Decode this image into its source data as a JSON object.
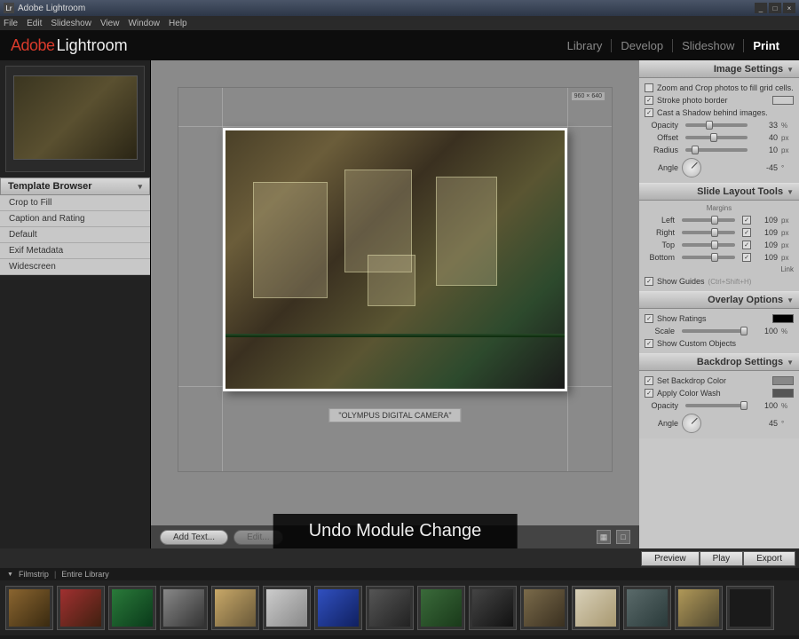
{
  "window": {
    "title": "Adobe Lightroom",
    "minimize": "_",
    "maximize": "□",
    "close": "×"
  },
  "menubar": [
    "File",
    "Edit",
    "Slideshow",
    "View",
    "Window",
    "Help"
  ],
  "brand": {
    "adobe": "Adobe",
    "lightroom": "Lightroom"
  },
  "modules": {
    "items": [
      "Library",
      "Develop",
      "Slideshow",
      "Print"
    ],
    "active": "Print"
  },
  "left": {
    "preview_caption": "",
    "template_browser": {
      "title": "Template Browser",
      "items": [
        "Crop to Fill",
        "Caption and Rating",
        "Default",
        "Exif Metadata",
        "Widescreen"
      ]
    }
  },
  "center": {
    "dim_badge": "960 × 640",
    "caption": "\"OLYMPUS DIGITAL CAMERA\"",
    "toolbar": {
      "add_text": "Add Text...",
      "edit": "Edit..."
    }
  },
  "toast": "Undo Module Change",
  "right": {
    "image_settings": {
      "title": "Image Settings",
      "zoom_crop": "Zoom and Crop photos to fill grid cells.",
      "zoom_crop_checked": false,
      "stroke": "Stroke photo border",
      "stroke_checked": true,
      "stroke_color": "#cccccc",
      "shadow": "Cast a Shadow behind images.",
      "shadow_checked": true,
      "opacity": {
        "label": "Opacity",
        "value": "33",
        "unit": "%",
        "pos": 33
      },
      "offset": {
        "label": "Offset",
        "value": "40",
        "unit": "px",
        "pos": 40
      },
      "radius": {
        "label": "Radius",
        "value": "10",
        "unit": "px",
        "pos": 10
      },
      "angle": {
        "label": "Angle",
        "value": "-45",
        "unit": "°"
      }
    },
    "slide_layout": {
      "title": "Slide Layout Tools",
      "margins_label": "Margins",
      "left": {
        "label": "Left",
        "value": "109",
        "unit": "px",
        "checked": true,
        "pos": 55
      },
      "right": {
        "label": "Right",
        "value": "109",
        "unit": "px",
        "checked": true,
        "pos": 55
      },
      "top": {
        "label": "Top",
        "value": "109",
        "unit": "px",
        "checked": true,
        "pos": 55
      },
      "bottom": {
        "label": "Bottom",
        "value": "109",
        "unit": "px",
        "checked": true,
        "pos": 55
      },
      "link": "Link",
      "guides": {
        "label": "Show Guides",
        "hint": "(Ctrl+Shift+H)",
        "checked": true
      }
    },
    "overlay": {
      "title": "Overlay Options",
      "ratings": {
        "label": "Show Ratings",
        "checked": true,
        "color": "#000000"
      },
      "scale": {
        "label": "Scale",
        "value": "100",
        "unit": "%",
        "pos": 100
      },
      "custom": {
        "label": "Show Custom Objects",
        "checked": true
      }
    },
    "backdrop": {
      "title": "Backdrop Settings",
      "bgcolor": {
        "label": "Set Backdrop Color",
        "checked": true,
        "color": "#888888"
      },
      "wash": {
        "label": "Apply Color Wash",
        "checked": true,
        "color": "#555555"
      },
      "opacity": {
        "label": "Opacity",
        "value": "100",
        "unit": "%",
        "pos": 100
      },
      "angle": {
        "label": "Angle",
        "value": "45",
        "unit": "°"
      }
    }
  },
  "actions": {
    "preview": "Preview",
    "play": "Play",
    "export": "Export"
  },
  "filmstrip": {
    "label": "Filmstrip",
    "scope": "Entire Library",
    "count": 15
  }
}
